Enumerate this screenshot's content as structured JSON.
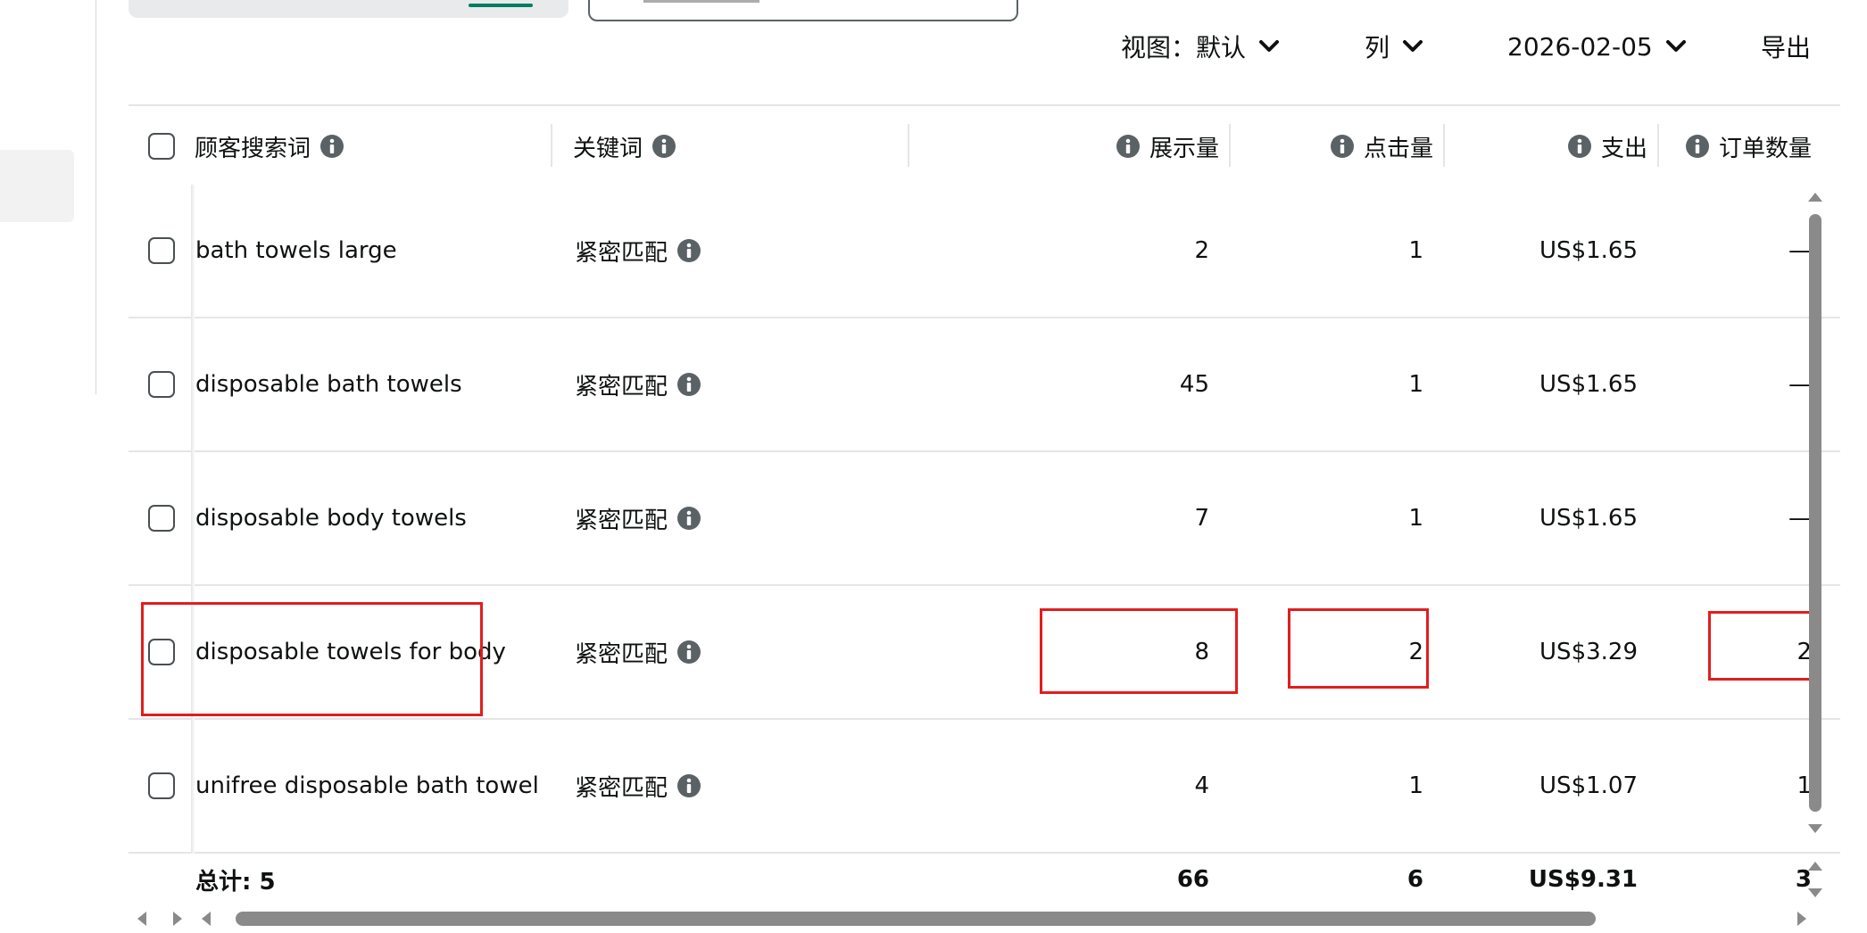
{
  "toolbar": {
    "view_label": "视图：默认",
    "columns_label": "列",
    "date_label": "2026-02-05",
    "export_label": "导出"
  },
  "headers": {
    "search_term": "顾客搜索词",
    "keyword": "关键词",
    "impressions": "展示量",
    "clicks": "点击量",
    "spend": "支出",
    "orders": "订单数量"
  },
  "rows": [
    {
      "term": "bath towels large",
      "match": "紧密匹配",
      "impressions": "2",
      "clicks": "1",
      "spend": "US$1.65",
      "orders": "—"
    },
    {
      "term": "disposable bath towels",
      "match": "紧密匹配",
      "impressions": "45",
      "clicks": "1",
      "spend": "US$1.65",
      "orders": "—"
    },
    {
      "term": "disposable body towels",
      "match": "紧密匹配",
      "impressions": "7",
      "clicks": "1",
      "spend": "US$1.65",
      "orders": "—"
    },
    {
      "term": "disposable towels for body",
      "match": "紧密匹配",
      "impressions": "8",
      "clicks": "2",
      "spend": "US$3.29",
      "orders": "2"
    },
    {
      "term": "unifree disposable bath towel",
      "match": "紧密匹配",
      "impressions": "4",
      "clicks": "1",
      "spend": "US$1.07",
      "orders": "1"
    }
  ],
  "totals": {
    "label": "总计: 5",
    "impressions": "66",
    "clicks": "6",
    "spend": "US$9.31",
    "orders": "3"
  },
  "icons": {
    "info": "info-icon",
    "chevron": "chevron-down-icon"
  },
  "colors": {
    "highlight": "#e31d1d",
    "scrollbar": "#8a8a8a",
    "brand_green": "#067d62"
  }
}
